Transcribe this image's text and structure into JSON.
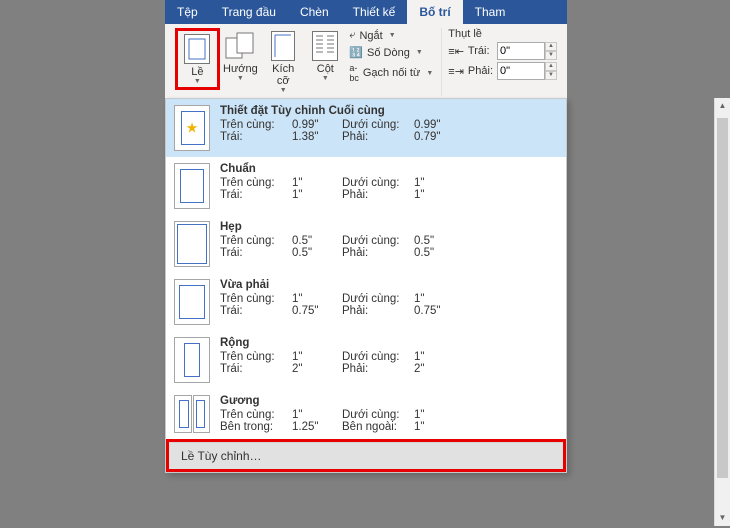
{
  "tabs": {
    "file": "Tệp",
    "home": "Trang đầu",
    "insert": "Chèn",
    "design": "Thiết kế",
    "layout": "Bố trí",
    "references": "Tham"
  },
  "ribbon": {
    "margins": {
      "label": "Lề"
    },
    "orientation": {
      "label": "Hướng"
    },
    "size": {
      "label": "Kích cỡ"
    },
    "columns": {
      "label": "Cột"
    },
    "breaks": "Ngắt",
    "line_numbers": "Số Dòng",
    "hyphenation": "Gạch nối từ",
    "indent": {
      "header": "Thụt lề",
      "left_label": "Trái:",
      "right_label": "Phải:",
      "left_value": "0\"",
      "right_value": "0\""
    }
  },
  "presets": [
    {
      "id": "last-custom",
      "name": "Thiết đặt Tùy chỉnh Cuối cùng",
      "rows": [
        {
          "l1": "Trên cùng:",
          "v1": "0.99\"",
          "l2": "Dưới cùng:",
          "v2": "0.99\""
        },
        {
          "l1": "Trái:",
          "v1": "1.38\"",
          "l2": "Phải:",
          "v2": "0.79\""
        }
      ],
      "icon": "custom",
      "selected": true
    },
    {
      "id": "normal",
      "name": "Chuẩn",
      "rows": [
        {
          "l1": "Trên cùng:",
          "v1": "1\"",
          "l2": "Dưới cùng:",
          "v2": "1\""
        },
        {
          "l1": "Trái:",
          "v1": "1\"",
          "l2": "Phải:",
          "v2": "1\""
        }
      ],
      "icon": "normal"
    },
    {
      "id": "narrow",
      "name": "Hẹp",
      "rows": [
        {
          "l1": "Trên cùng:",
          "v1": "0.5\"",
          "l2": "Dưới cùng:",
          "v2": "0.5\""
        },
        {
          "l1": "Trái:",
          "v1": "0.5\"",
          "l2": "Phải:",
          "v2": "0.5\""
        }
      ],
      "icon": "narrow"
    },
    {
      "id": "moderate",
      "name": "Vừa phải",
      "rows": [
        {
          "l1": "Trên cùng:",
          "v1": "1\"",
          "l2": "Dưới cùng:",
          "v2": "1\""
        },
        {
          "l1": "Trái:",
          "v1": "0.75\"",
          "l2": "Phải:",
          "v2": "0.75\""
        }
      ],
      "icon": "moderate"
    },
    {
      "id": "wide",
      "name": "Rộng",
      "rows": [
        {
          "l1": "Trên cùng:",
          "v1": "1\"",
          "l2": "Dưới cùng:",
          "v2": "1\""
        },
        {
          "l1": "Trái:",
          "v1": "2\"",
          "l2": "Phải:",
          "v2": "2\""
        }
      ],
      "icon": "wide"
    },
    {
      "id": "mirrored",
      "name": "Gương",
      "rows": [
        {
          "l1": "Trên cùng:",
          "v1": "1\"",
          "l2": "Dưới cùng:",
          "v2": "1\""
        },
        {
          "l1": "Bên trong:",
          "v1": "1.25\"",
          "l2": "Bên ngoài:",
          "v2": "1\""
        }
      ],
      "icon": "mirror"
    }
  ],
  "custom_margins": "Lề Tùy chỉnh…"
}
